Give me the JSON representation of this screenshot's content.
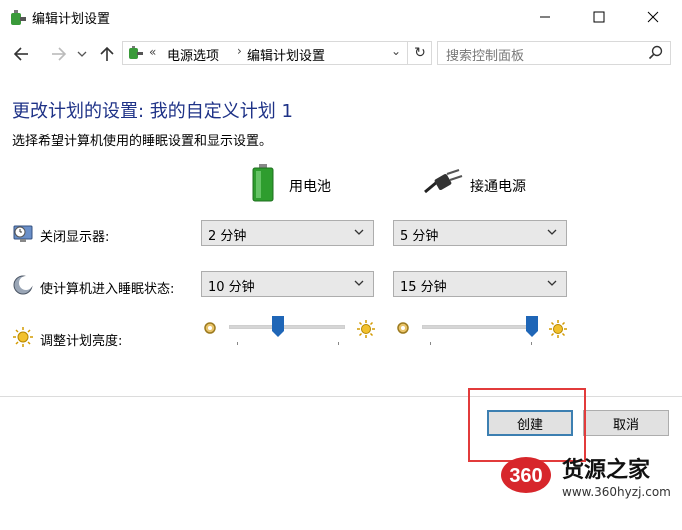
{
  "window": {
    "title": "编辑计划设置",
    "minimize_label": "—",
    "maximize_label": "☐",
    "close_label": "✕"
  },
  "nav": {
    "back_icon": "arrow-left-icon",
    "forward_icon": "arrow-right-icon",
    "recent_icon": "chevron-down-icon",
    "up_icon": "arrow-up-icon",
    "breadcrumb_chevron": "«",
    "breadcrumb": [
      "电源选项",
      "编辑计划设置"
    ],
    "breadcrumb_separator": "›",
    "dropdown_glyph": "⌄",
    "refresh_glyph": "↻",
    "search_placeholder": "搜索控制面板"
  },
  "content": {
    "heading": "更改计划的设置: 我的自定义计划 1",
    "subheading": "选择希望计算机使用的睡眠设置和显示设置。",
    "columns": [
      {
        "label": "用电池",
        "icon": "battery-icon"
      },
      {
        "label": "接通电源",
        "icon": "plug-icon"
      }
    ],
    "rows": [
      {
        "label": "关闭显示器:",
        "icon": "display-clock-icon",
        "battery_value": "2 分钟",
        "plugged_value": "5 分钟"
      },
      {
        "label": "使计算机进入睡眠状态:",
        "icon": "moon-icon",
        "battery_value": "10 分钟",
        "plugged_value": "15 分钟"
      }
    ],
    "brightness": {
      "label": "调整计划亮度:",
      "icon": "sun-icon",
      "battery_level": 0.42,
      "plugged_level": 0.95
    }
  },
  "buttons": {
    "create": "创建",
    "cancel": "取消"
  },
  "watermark": {
    "logo_text": "360",
    "brand": "货源之家",
    "url": "www.360hyzj.com"
  },
  "colors": {
    "heading": "#1e3287",
    "highlight": "#e23b3b",
    "default_button_border": "#3c7fb1"
  }
}
